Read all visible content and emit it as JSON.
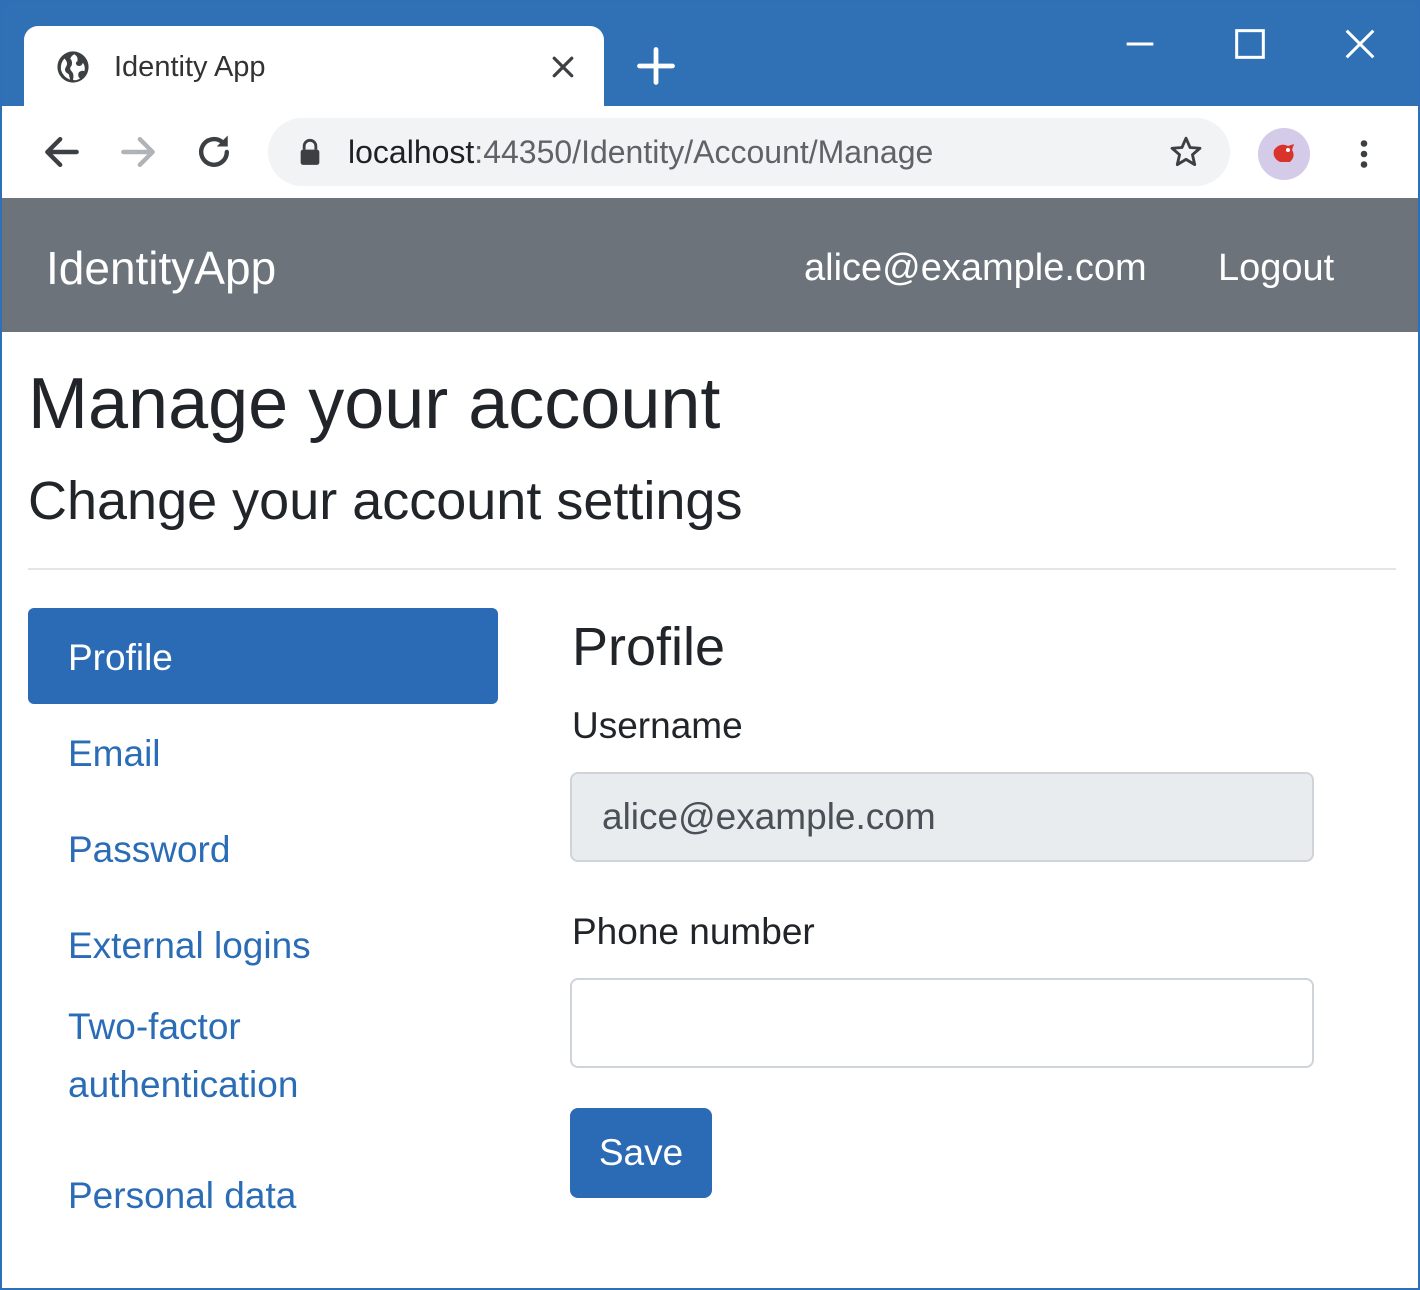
{
  "browser": {
    "tab_title": "Identity App",
    "url_host": "localhost",
    "url_path": ":44350/Identity/Account/Manage"
  },
  "navbar": {
    "brand": "IdentityApp",
    "user": "alice@example.com",
    "logout": "Logout"
  },
  "page": {
    "title": "Manage your account",
    "subtitle": "Change your account settings"
  },
  "sidebar": {
    "items": [
      {
        "label": "Profile",
        "active": true
      },
      {
        "label": "Email",
        "active": false
      },
      {
        "label": "Password",
        "active": false
      },
      {
        "label": "External logins",
        "active": false
      },
      {
        "label": "Two-factor authentication",
        "active": false
      },
      {
        "label": "Personal data",
        "active": false
      }
    ]
  },
  "form": {
    "heading": "Profile",
    "username_label": "Username",
    "username_value": "alice@example.com",
    "phone_label": "Phone number",
    "phone_value": "",
    "save_label": "Save"
  },
  "colors": {
    "tabstrip": "#3071b5",
    "navbar": "#6c737b",
    "primary": "#2b6bb5"
  },
  "icons": [
    "globe-icon",
    "close-icon",
    "plus-icon",
    "minimize-icon",
    "maximize-icon",
    "window-close-icon",
    "back-arrow-icon",
    "forward-arrow-icon",
    "reload-icon",
    "lock-icon",
    "star-icon",
    "avatar-icon",
    "more-vert-icon"
  ]
}
